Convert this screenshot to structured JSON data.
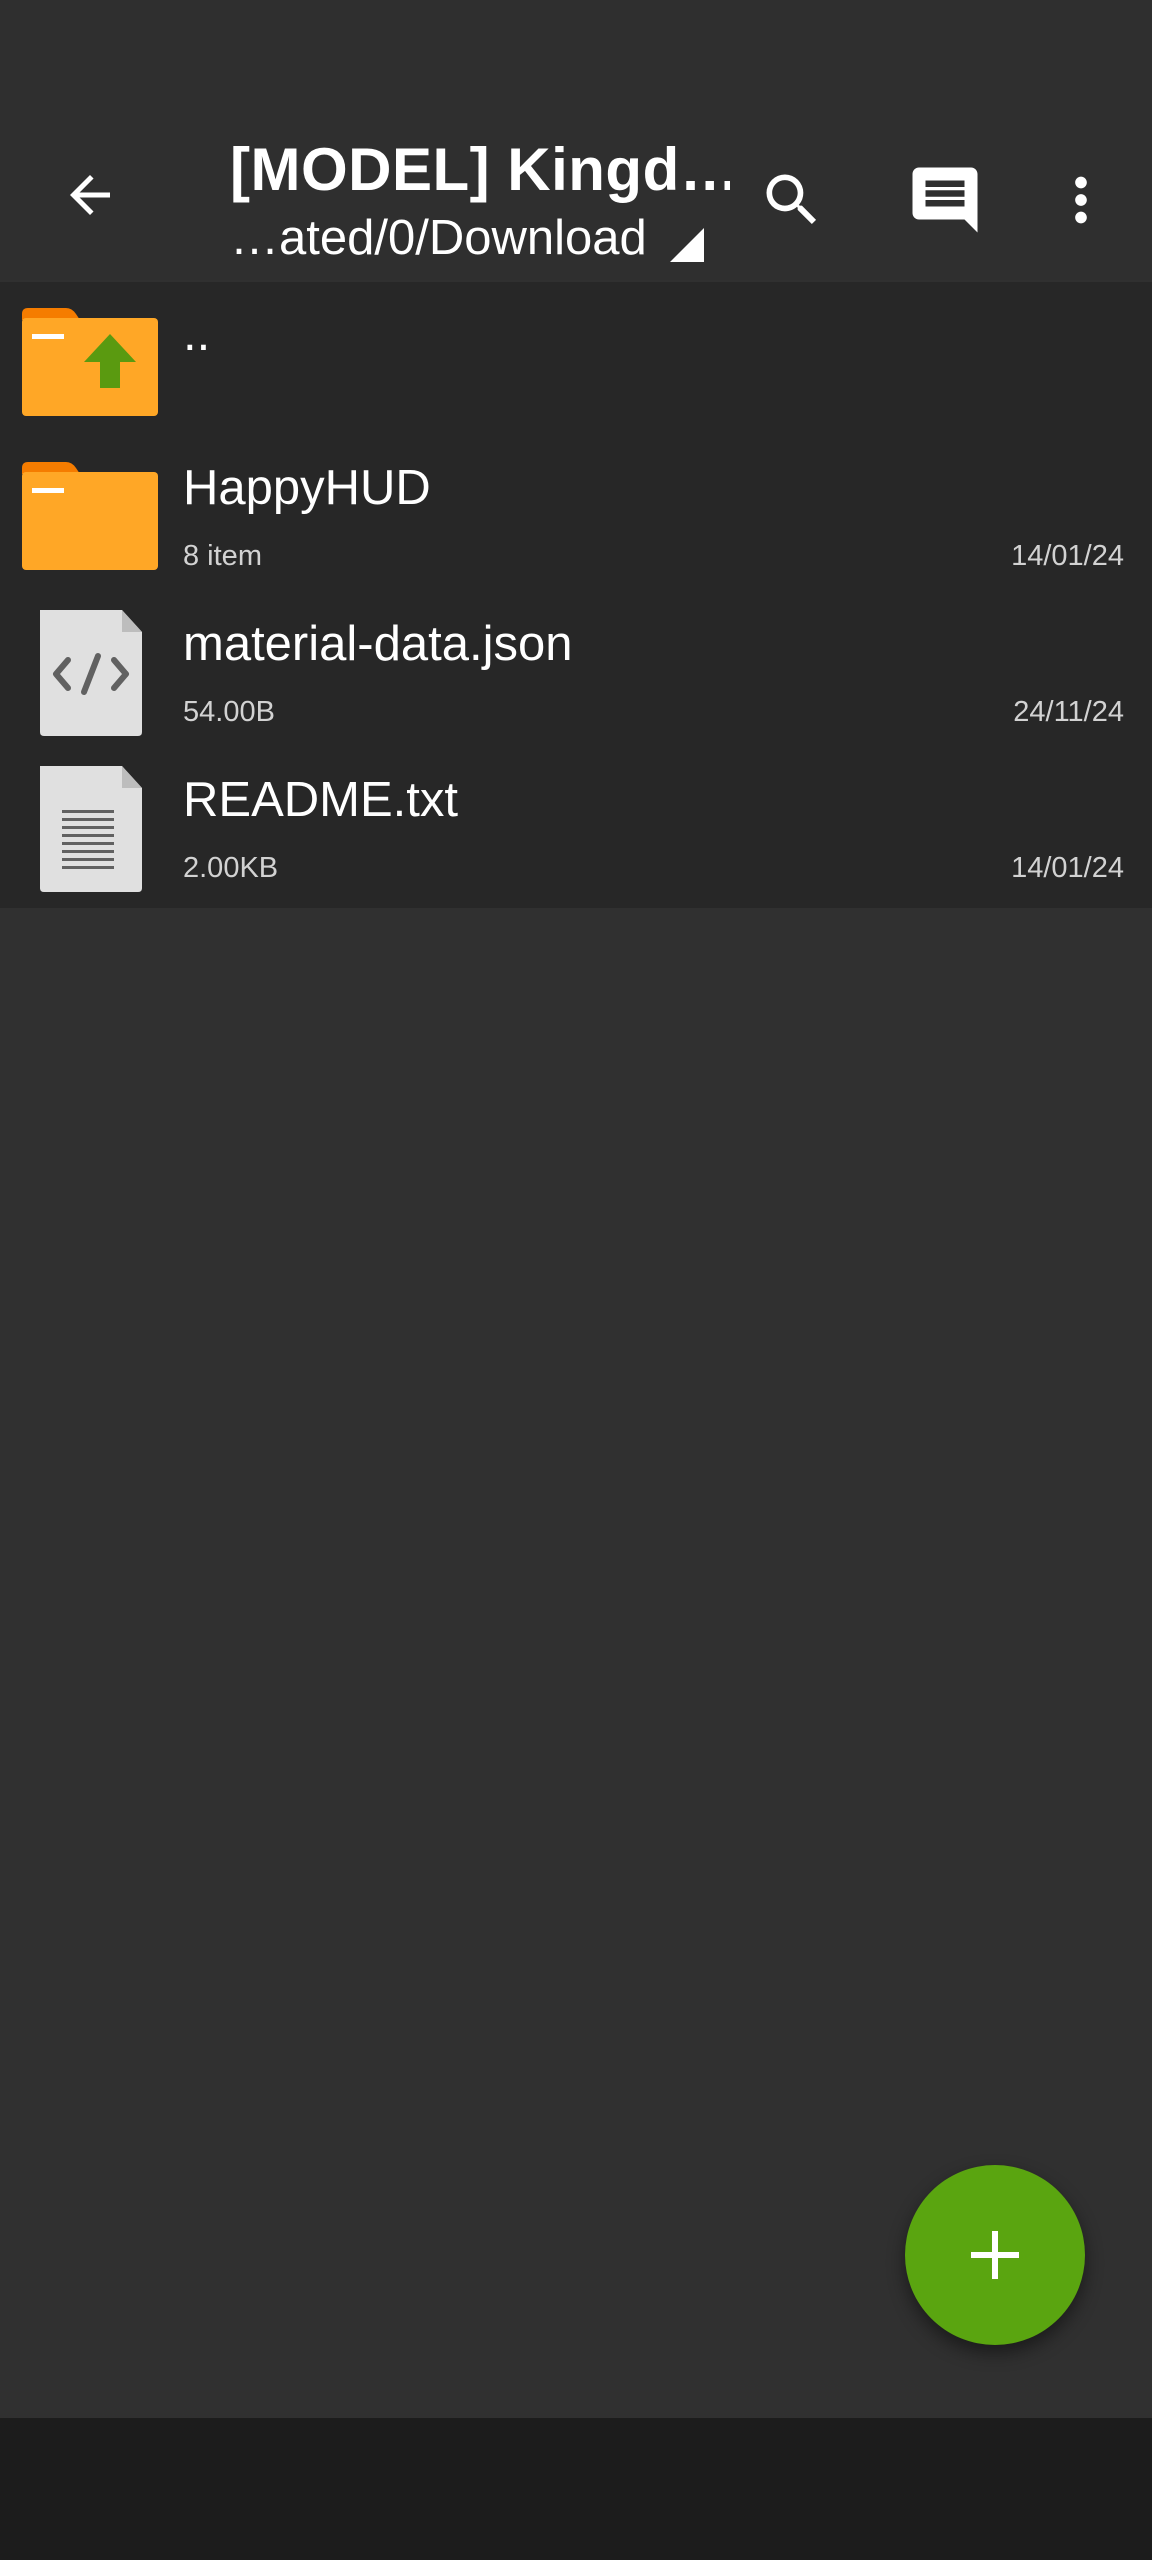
{
  "header": {
    "title": "[MODEL] Kingd…",
    "path": "…ated/0/Download",
    "icons": {
      "back": "arrow-back-icon",
      "search": "search-icon",
      "messages": "message-icon",
      "more": "more-vert-icon"
    }
  },
  "files": [
    {
      "name": "..",
      "meta": "",
      "date": "",
      "icon": "folder-up-icon"
    },
    {
      "name": "HappyHUD",
      "meta": "8 item",
      "date": "14/01/24",
      "icon": "folder-icon"
    },
    {
      "name": "material-data.json",
      "meta": "54.00B",
      "date": "24/11/24",
      "icon": "code-file-icon"
    },
    {
      "name": "README.txt",
      "meta": "2.00KB",
      "date": "14/01/24",
      "icon": "text-file-icon"
    }
  ],
  "fab": {
    "icon": "plus-icon"
  },
  "colors": {
    "background": "#303030",
    "list_background": "#272727",
    "folder": "#ffa726",
    "folder_tab": "#f57c00",
    "up_arrow": "#5a9a10",
    "fab": "#5aa510",
    "nav_bar": "#1c1c1c"
  }
}
